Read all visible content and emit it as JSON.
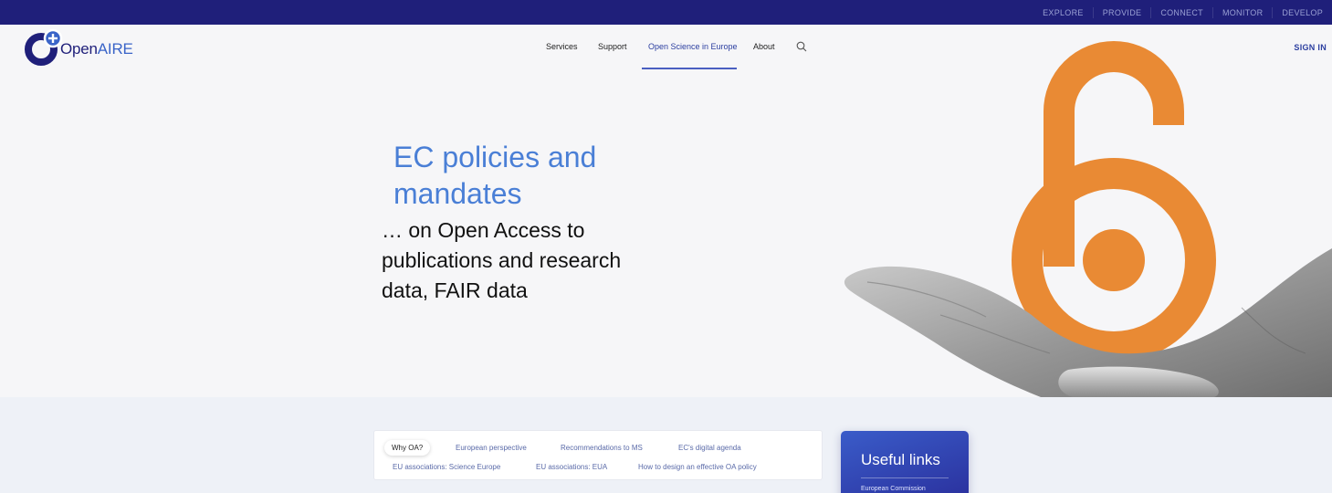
{
  "topbar": {
    "links": [
      "EXPLORE",
      "PROVIDE",
      "CONNECT",
      "MONITOR",
      "DEVELOP"
    ]
  },
  "header": {
    "logo_text_1": "Open",
    "logo_text_2": "AIRE",
    "nav": [
      "Services",
      "Support",
      "Open Science in Europe",
      "About"
    ],
    "active_nav": "Open Science in Europe",
    "signin": "SIGN IN"
  },
  "hero": {
    "title": "EC policies and mandates",
    "subtitle": "… on Open Access to publications and research data,  FAIR data"
  },
  "tabs": {
    "row1": [
      "Why OA?",
      "European perspective",
      "Recommendations to MS",
      "EC's digital agenda"
    ],
    "row2": [
      "EU associations: Science Europe",
      "EU associations: EUA",
      "How to design an effective OA policy"
    ],
    "active": "Why OA?"
  },
  "useful_links": {
    "title": "Useful links",
    "first_item": "European Commission"
  },
  "colors": {
    "topbar": "#1f1f7a",
    "accent_blue": "#4a7fd6",
    "nav_active": "#2c3fa0",
    "oa_orange": "#e98a34",
    "card_gradient_start": "#3a5cc9",
    "card_gradient_end": "#2a2f9c"
  },
  "icons": {
    "search": "search-icon",
    "logo": "openaire-logo-icon",
    "open_access": "open-access-lock-icon",
    "hand": "hand-illustration"
  }
}
